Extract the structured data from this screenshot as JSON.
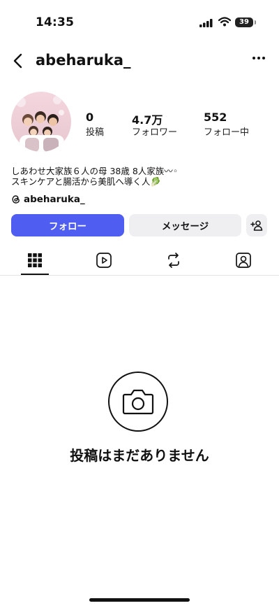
{
  "status_bar": {
    "time": "14:35",
    "battery": "39"
  },
  "header": {
    "username": "abeharuka_"
  },
  "stats": [
    {
      "value": "0",
      "label": "投稿"
    },
    {
      "value": "4.7万",
      "label": "フォロワー"
    },
    {
      "value": "552",
      "label": "フォロー中"
    }
  ],
  "bio": {
    "line1": "しあわせ大家族６人の母 38歳 8人家族〰︎◦",
    "line2": "スキンケアと腸活から美肌へ導く人🥬"
  },
  "threads_handle": "abeharuka_",
  "buttons": {
    "follow": "フォロー",
    "message": "メッセージ"
  },
  "tabs": [
    "grid-icon",
    "reels-icon",
    "repost-icon",
    "tagged-icon"
  ],
  "empty_state": {
    "text": "投稿はまだありません"
  },
  "colors": {
    "accent": "#4f5df0",
    "secondary_button": "#efeff2"
  }
}
